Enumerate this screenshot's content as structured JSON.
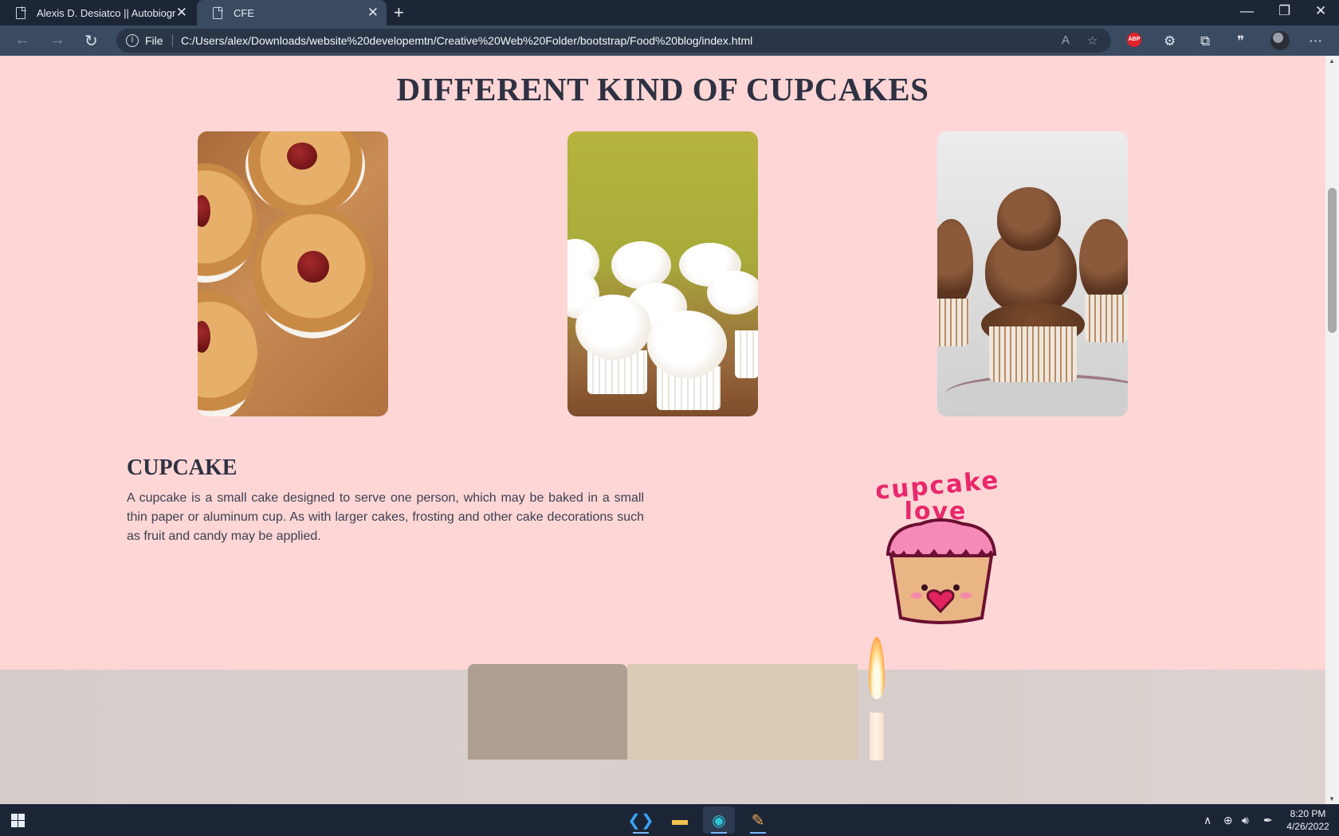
{
  "browser": {
    "tabs": [
      {
        "title": "Alexis D. Desiatco || Autobiograp",
        "active": false
      },
      {
        "title": "CFE",
        "active": true
      }
    ],
    "address": {
      "scheme_label": "File",
      "url": "C:/Users/alex/Downloads/website%20developemtn/Creative%20Web%20Folder/bootstrap/Food%20blog/index.html"
    },
    "extensions": {
      "adblock_label": "ABP"
    }
  },
  "page": {
    "heading": "DIFFERENT KIND OF CUPCAKES",
    "section": {
      "title": "CUPCAKE",
      "text": "A cupcake is a small cake designed to serve one person, which may be baked in a small thin paper or aluminum cup. As with larger cakes, frosting and other cake decorations such as fruit and candy may be applied."
    },
    "logo": {
      "line1": "cupcake",
      "line2": "love"
    }
  },
  "taskbar": {
    "time": "8:20 PM",
    "date": "4/26/2022"
  },
  "colors": {
    "page_bg": "#ffd6d6",
    "heading": "#2d3142",
    "logo_pink": "#e8286a"
  }
}
